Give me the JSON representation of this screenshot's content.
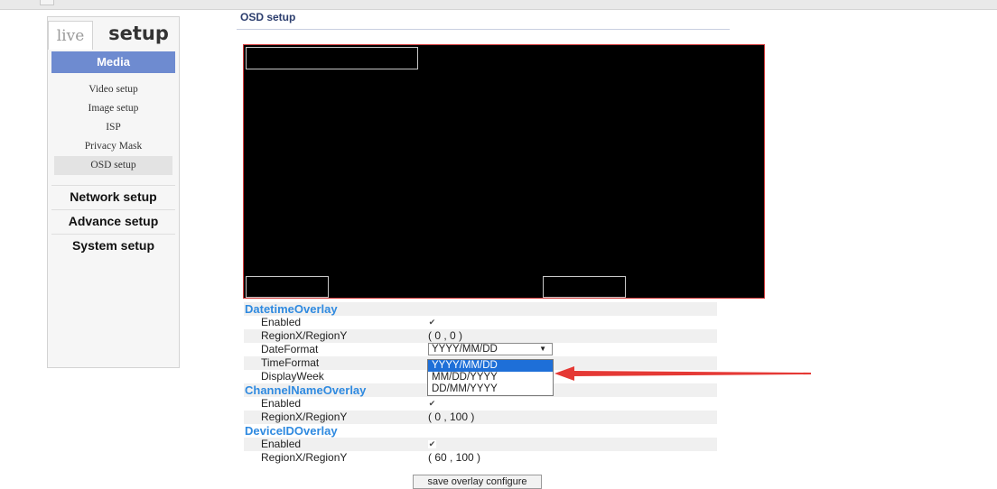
{
  "tabs": {
    "live": "live",
    "setup": "setup"
  },
  "sidebar": {
    "media_header": "Media",
    "media_items": [
      "Video setup",
      "Image setup",
      "ISP",
      "Privacy Mask",
      "OSD setup"
    ],
    "active_item": "OSD setup",
    "sections": [
      "Network setup",
      "Advance setup",
      "System setup"
    ]
  },
  "main": {
    "title": "OSD setup",
    "datetime": {
      "title": "DatetimeOverlay",
      "enabled_label": "Enabled",
      "enabled": true,
      "region_label": "RegionX/RegionY",
      "region_value": "( 0 ,  0 )",
      "dateformat_label": "DateFormat",
      "dateformat_value": "YYYY/MM/DD",
      "timeformat_label": "TimeFormat",
      "displayweek_label": "DisplayWeek"
    },
    "dropdown_options": [
      "YYYY/MM/DD",
      "MM/DD/YYYY",
      "DD/MM/YYYY"
    ],
    "channel": {
      "title": "ChannelNameOverlay",
      "enabled_label": "Enabled",
      "enabled": true,
      "region_label": "RegionX/RegionY",
      "region_value": "( 0 ,  100 )"
    },
    "device": {
      "title": "DeviceIDOverlay",
      "enabled_label": "Enabled",
      "enabled": true,
      "region_label": "RegionX/RegionY",
      "region_value": "( 60 ,  100 )"
    },
    "save_label": "save overlay configure"
  },
  "colors": {
    "media_header": "#6e8bd0",
    "group_title": "#2f8ae0",
    "preview_border": "#d23b3b",
    "annotation_arrow": "#e53935",
    "dropdown_selected": "#1e6fd8"
  }
}
